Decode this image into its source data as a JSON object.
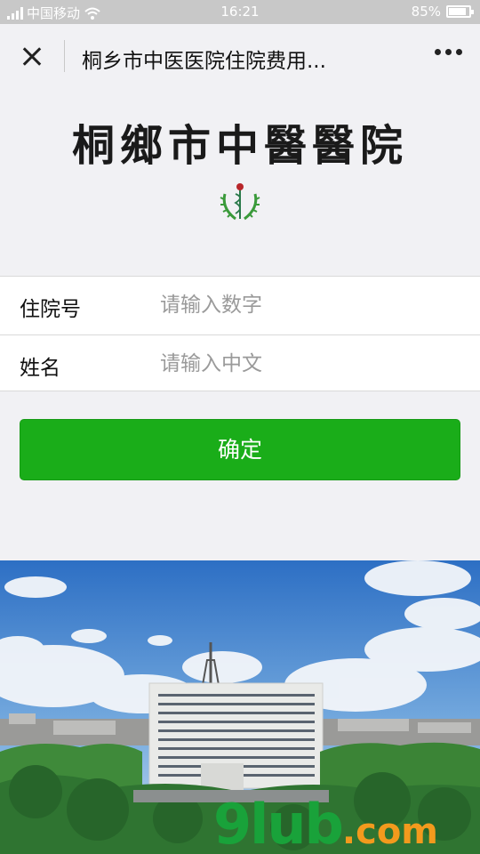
{
  "status_bar": {
    "carrier": "中国移动",
    "time": "16:21",
    "battery": "85%",
    "battery_level": 0.85
  },
  "nav": {
    "title": "桐乡市中医医院住院费用..."
  },
  "header": {
    "calligraphy_title": "桐鄉市中醫醫院",
    "emblem_text": "桐乡市中医医院"
  },
  "form": {
    "fields": [
      {
        "label": "住院号",
        "placeholder": "请输入数字",
        "value": ""
      },
      {
        "label": "姓名",
        "placeholder": "请输入中文",
        "value": ""
      }
    ],
    "submit_label": "确定"
  },
  "photo": {
    "watermark_main": "9lub",
    "watermark_suffix": ".com"
  },
  "colors": {
    "primary_green": "#1aad19",
    "background": "#f1f1f4"
  }
}
